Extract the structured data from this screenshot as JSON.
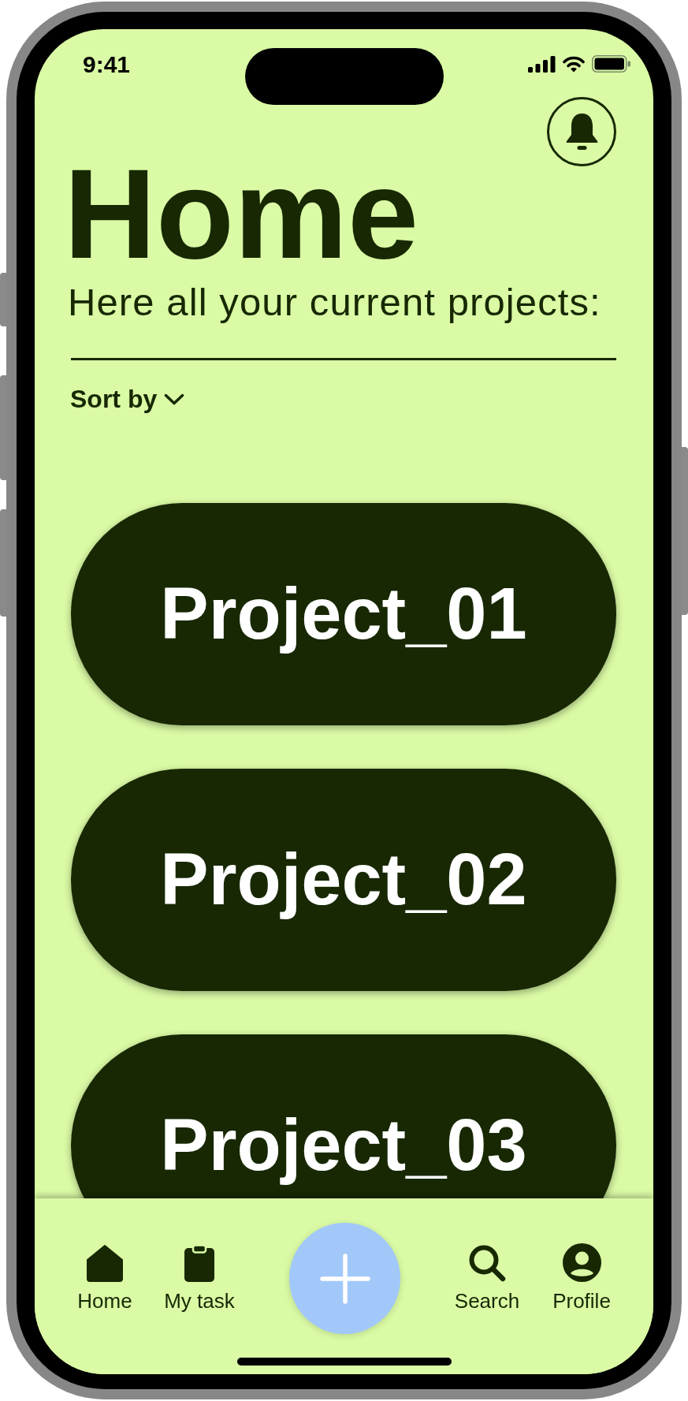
{
  "status_bar": {
    "time": "9:41"
  },
  "header": {
    "title": "Home",
    "subtitle": "Here all your current projects:"
  },
  "sort": {
    "label": "Sort by"
  },
  "projects": [
    {
      "name": "Project_01"
    },
    {
      "name": "Project_02"
    },
    {
      "name": "Project_03"
    }
  ],
  "tab_bar": [
    {
      "kind": "tab",
      "label": "Home"
    },
    {
      "kind": "tab",
      "label": "My task"
    },
    {
      "kind": "add"
    },
    {
      "kind": "tab",
      "label": "Search"
    },
    {
      "kind": "tab",
      "label": "Profile"
    }
  ]
}
